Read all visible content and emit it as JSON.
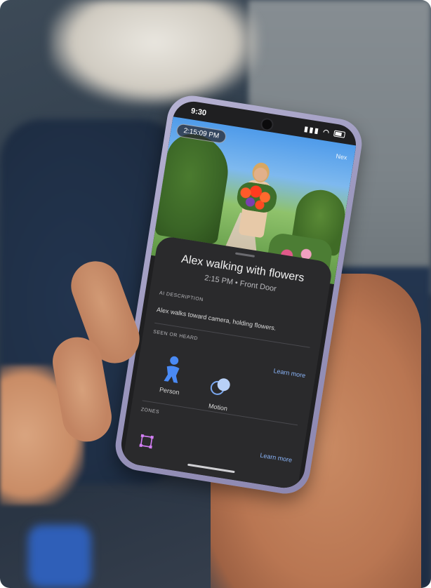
{
  "status_bar": {
    "time": "9:30"
  },
  "video": {
    "timestamp_pill": "2:15:09 PM",
    "next_label": "Nex"
  },
  "event_sheet": {
    "title": "Alex walking with flowers",
    "time": "2:15 PM",
    "separator": "•",
    "location": "Front Door",
    "ai_description_label": "AI DESCRIPTION",
    "ai_description_text": "Alex walks toward camera, holding flowers.",
    "seen_or_heard_label": "SEEN OR HEARD",
    "learn_more_1": "Learn more",
    "detections": [
      {
        "label": "Person",
        "icon": "person-icon"
      },
      {
        "label": "Motion",
        "icon": "motion-icon"
      }
    ],
    "zones_label": "ZONES",
    "learn_more_2": "Learn more",
    "zone_icon": "zone-icon"
  },
  "colors": {
    "phone_frame": "#9a96bd",
    "sheet_bg": "#2a2a2c",
    "link": "#8ab4f8",
    "person_icon": "#4a8af4",
    "zone_icon": "#d37ff5"
  }
}
